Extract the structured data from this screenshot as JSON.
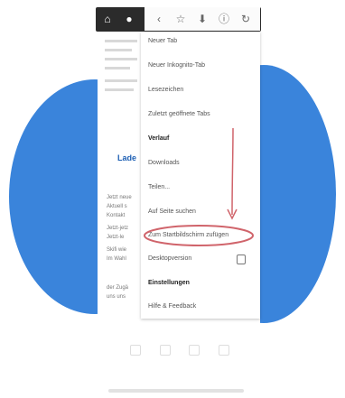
{
  "toolbar": {
    "icons": [
      "home-icon",
      "drop-icon",
      "back-icon",
      "bookmark-star-icon",
      "download-icon",
      "info-icon",
      "reload-icon"
    ]
  },
  "menu": {
    "items": [
      {
        "label": "Neuer Tab"
      },
      {
        "label": "Neuer Inkognito-Tab"
      },
      {
        "label": "Lesezeichen"
      },
      {
        "label": "Zuletzt geöffnete Tabs"
      },
      {
        "label": "Verlauf"
      },
      {
        "label": "Downloads"
      },
      {
        "label": "Teilen..."
      },
      {
        "label": "Auf Seite suchen"
      },
      {
        "label": "Zum Startbildschirm zufügen"
      },
      {
        "label": "Desktopversion"
      },
      {
        "label": "Einstellungen"
      },
      {
        "label": "Hilfe & Feedback"
      }
    ]
  },
  "background_page": {
    "title_fragment": "Lade",
    "text_lines": [
      "Jetzt neue",
      "Aktuell s",
      "Kontakt",
      "Jetzt-jetz",
      "Jetzt-le",
      "Skifi wie",
      "Im Wahl",
      "der Zugä",
      "uns uns"
    ]
  },
  "colors": {
    "accent_blue": "#3a84db",
    "annotation_red": "#d0646b",
    "toolbar_dark": "#2b2b2b"
  }
}
